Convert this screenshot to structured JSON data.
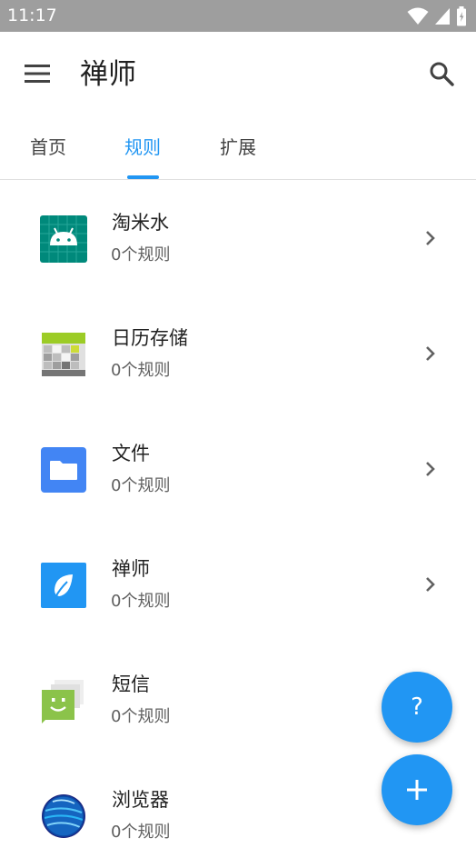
{
  "status_bar": {
    "time": "11:17",
    "icons": [
      "wifi-icon",
      "cell-signal-icon",
      "battery-icon"
    ]
  },
  "app_bar": {
    "title": "禅师",
    "menu_icon": "hamburger-menu-icon",
    "search_icon": "search-icon"
  },
  "tabs": [
    {
      "label": "首页",
      "active": false
    },
    {
      "label": "规则",
      "active": true
    },
    {
      "label": "扩展",
      "active": false
    }
  ],
  "colors": {
    "accent": "#2196f3",
    "status_bar": "#9e9e9e"
  },
  "apps": [
    {
      "name": "淘米水",
      "rules": "0个规则",
      "icon": "android-icon"
    },
    {
      "name": "日历存储",
      "rules": "0个规则",
      "icon": "calendar-storage-icon"
    },
    {
      "name": "文件",
      "rules": "0个规则",
      "icon": "files-folder-icon"
    },
    {
      "name": "禅师",
      "rules": "0个规则",
      "icon": "leaf-icon"
    },
    {
      "name": "短信",
      "rules": "0个规则",
      "icon": "sms-icon"
    },
    {
      "name": "浏览器",
      "rules": "0个规则",
      "icon": "browser-globe-icon"
    }
  ],
  "fabs": {
    "help_label": "?",
    "add_icon": "plus-icon"
  }
}
